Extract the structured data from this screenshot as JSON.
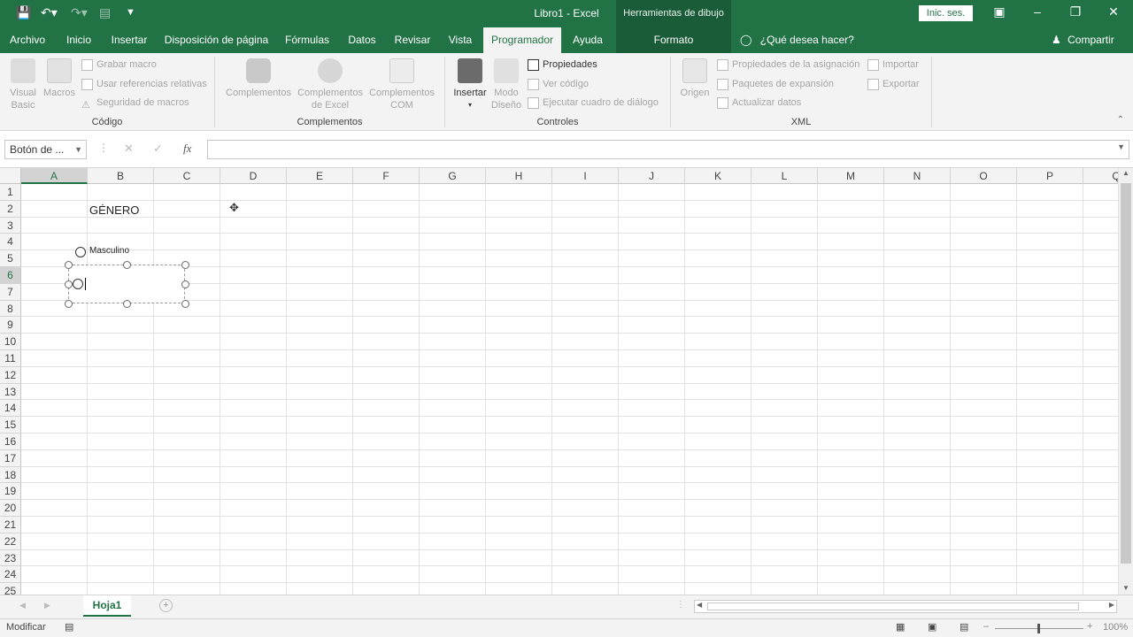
{
  "titlebar": {
    "title": "Libro1  -  Excel",
    "context_tools": "Herramientas de dibujo",
    "signin": "Inic. ses."
  },
  "tabs": [
    "Archivo",
    "Inicio",
    "Insertar",
    "Disposición de página",
    "Fórmulas",
    "Datos",
    "Revisar",
    "Vista",
    "Programador",
    "Ayuda"
  ],
  "active_tab": "Programador",
  "format_tab": "Formato",
  "tell_me": "¿Qué desea hacer?",
  "share": "Compartir",
  "ribbon": {
    "codigo": {
      "label": "Código",
      "visual_basic": "Visual Basic",
      "macros": "Macros",
      "grabar": "Grabar macro",
      "referencias": "Usar referencias relativas",
      "seguridad": "Seguridad de macros"
    },
    "complementos": {
      "label": "Complementos",
      "complementos": "Complementos",
      "excel": "Complementos de Excel",
      "com": "Complementos COM"
    },
    "controles": {
      "label": "Controles",
      "insertar": "Insertar",
      "modo": "Modo Diseño",
      "propiedades": "Propiedades",
      "ver_codigo": "Ver código",
      "ejecutar": "Ejecutar cuadro de diálogo"
    },
    "xml": {
      "label": "XML",
      "origen": "Origen",
      "prop_asignacion": "Propiedades de la asignación",
      "paquetes": "Paquetes de expansión",
      "actualizar": "Actualizar datos",
      "importar": "Importar",
      "exportar": "Exportar"
    }
  },
  "namebox": "Botón de ...",
  "fx": "fx",
  "columns": [
    "A",
    "B",
    "C",
    "D",
    "E",
    "F",
    "G",
    "H",
    "I",
    "J",
    "K",
    "L",
    "M",
    "N",
    "O",
    "P",
    "Q"
  ],
  "selected_column": "A",
  "rows": [
    "1",
    "2",
    "3",
    "4",
    "5",
    "6",
    "7",
    "8",
    "9",
    "10",
    "11",
    "12",
    "13",
    "14",
    "15",
    "16",
    "17",
    "18",
    "19",
    "20",
    "21",
    "22",
    "23",
    "24",
    "25"
  ],
  "selected_row": "6",
  "cells": {
    "B2": "GÉNERO"
  },
  "controls": {
    "radio1_label": "Masculino"
  },
  "sheet_tab": "Hoja1",
  "status": {
    "mode": "Modificar",
    "zoom": "100%"
  },
  "colors": {
    "brand": "#217346",
    "brand_dark": "#1a5c38",
    "ribbon_bg": "#f3f3f3"
  }
}
